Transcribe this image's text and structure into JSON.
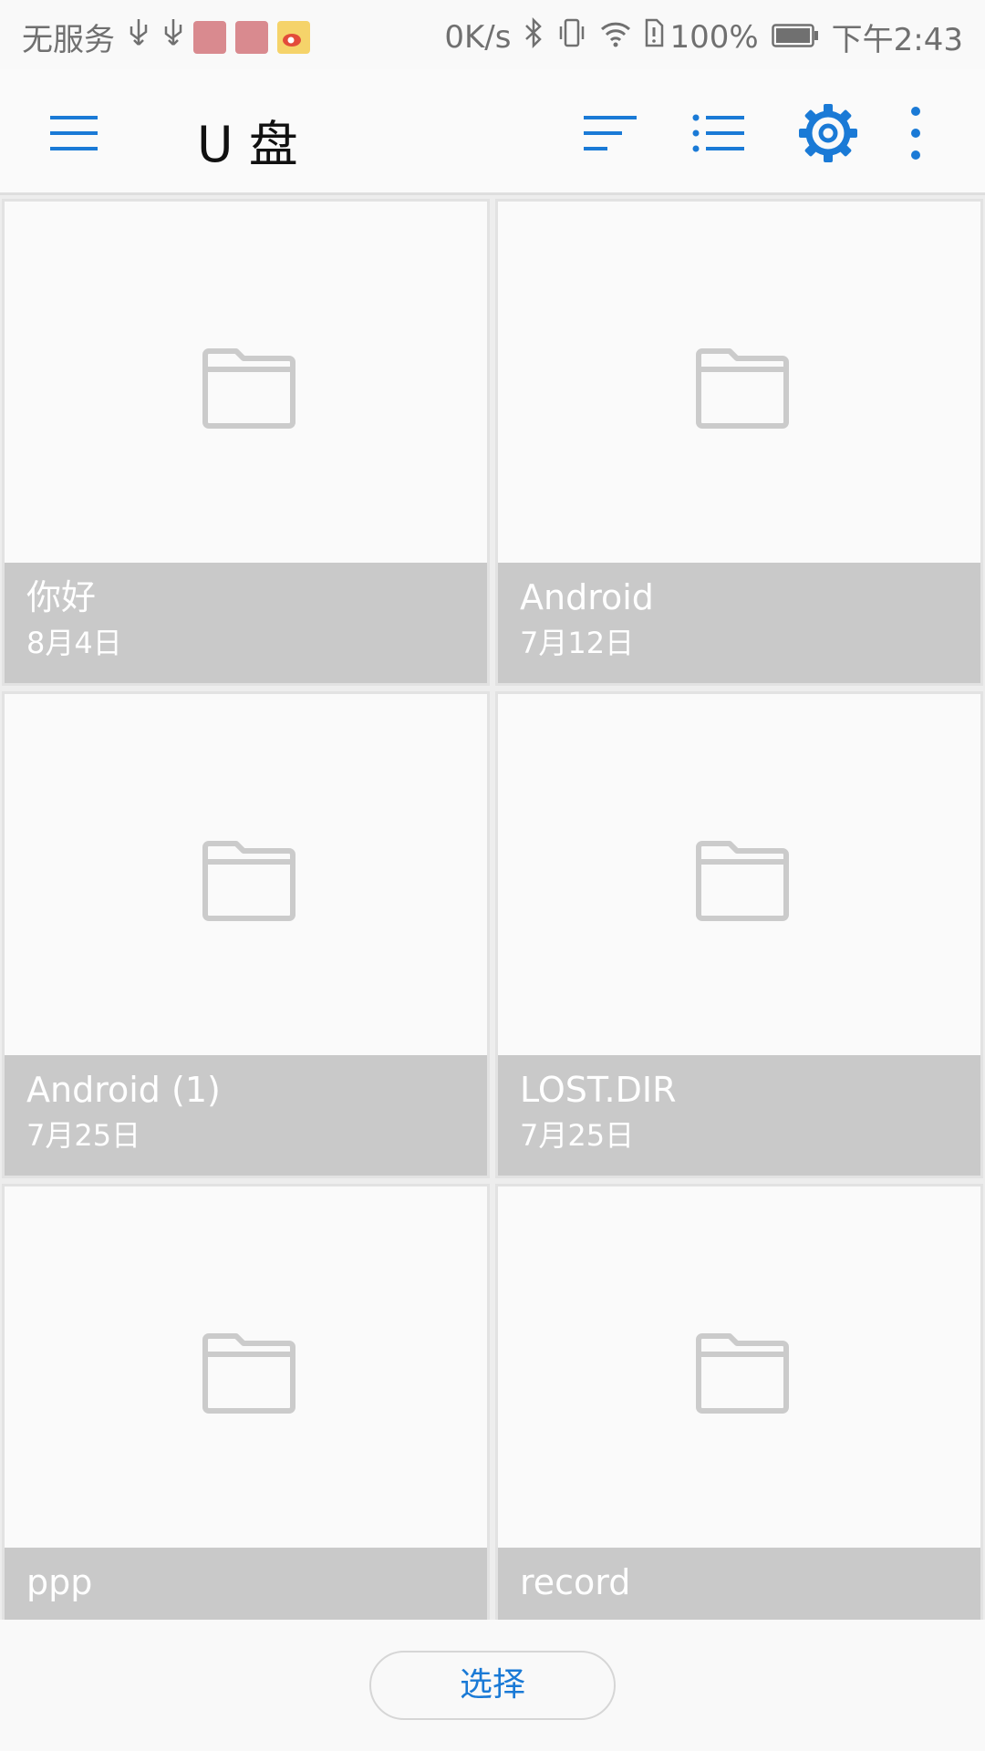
{
  "status_bar": {
    "carrier": "无服务",
    "speed": "0K/s",
    "battery": "100%",
    "time": "下午2:43",
    "icons": [
      "usb-icon",
      "usb-icon",
      "huawei-app-icon",
      "huawei-app-icon",
      "weibo-icon",
      "bluetooth-icon",
      "vibrate-icon",
      "wifi-icon",
      "sim-alert-icon",
      "battery-icon"
    ]
  },
  "app_bar": {
    "title": "U 盘",
    "accent": "#1a7ad6",
    "actions": [
      "menu-icon",
      "sort-icon",
      "list-view-icon",
      "settings-icon",
      "more-icon"
    ]
  },
  "folders": [
    {
      "name": "你好",
      "date": "8月4日"
    },
    {
      "name": "Android",
      "date": "7月12日"
    },
    {
      "name": "Android (1)",
      "date": "7月25日"
    },
    {
      "name": "LOST.DIR",
      "date": "7月25日"
    },
    {
      "name": "ppp",
      "date": ""
    },
    {
      "name": "record",
      "date": ""
    }
  ],
  "bottom": {
    "select_label": "选择"
  }
}
